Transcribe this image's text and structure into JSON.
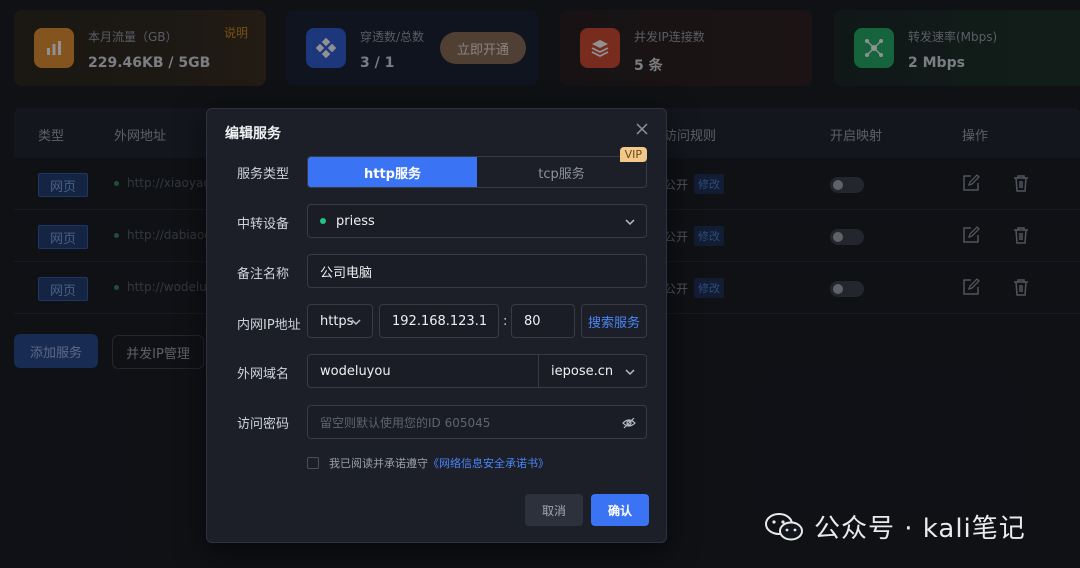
{
  "stats": [
    {
      "label": "本月流量（GB）",
      "value": "229.46KB / 5GB",
      "link": "说明",
      "icon": "bar-chart-icon",
      "icon_color": "#e8902a"
    },
    {
      "label": "穿透数/总数",
      "value": "3 / 1",
      "button": "立即开通",
      "icon": "diamond-grid-icon",
      "icon_color": "#2f5bd8"
    },
    {
      "label": "并发IP连接数",
      "value": "5 条",
      "icon": "layers-icon",
      "icon_color": "#d2472c"
    },
    {
      "label": "转发速率(Mbps)",
      "value": "2 Mbps",
      "icon": "network-hub-icon",
      "icon_color": "#1fae63"
    }
  ],
  "table": {
    "headers": [
      "类型",
      "外网地址",
      "访问规则",
      "开启映射",
      "操作"
    ],
    "rows": [
      {
        "type": "网页",
        "url": "http://xiaoyao",
        "rule": "公开",
        "badge": "修改"
      },
      {
        "type": "网页",
        "url": "http://dabiaog",
        "rule": "公开",
        "badge": "修改"
      },
      {
        "type": "网页",
        "url": "http://wodelu",
        "rule": "公开",
        "badge": "修改"
      }
    ]
  },
  "actions": {
    "add_service": "添加服务",
    "ip_manage": "并发IP管理"
  },
  "modal": {
    "title": "编辑服务",
    "labels": {
      "service_type": "服务类型",
      "relay_device": "中转设备",
      "remark": "备注名称",
      "lan_ip": "内网IP地址",
      "domain": "外网域名",
      "password": "访问密码"
    },
    "service_type": {
      "active": "http服务",
      "inactive": "tcp服务",
      "vip": "VIP"
    },
    "relay_device": "priess",
    "remark": "公司电脑",
    "protocol": "https",
    "ip": "192.168.123.1",
    "colon": ":",
    "port": "80",
    "search_button": "搜索服务",
    "subdomain": "wodeluyou",
    "root_domain": "iepose.cn",
    "password_placeholder": "留空则默认使用您的ID 605045",
    "agree_text": "我已阅读并承诺遵守",
    "agree_link": "《网络信息安全承诺书》",
    "cancel": "取消",
    "confirm": "确认"
  },
  "watermark": "公众号 · kali笔记"
}
